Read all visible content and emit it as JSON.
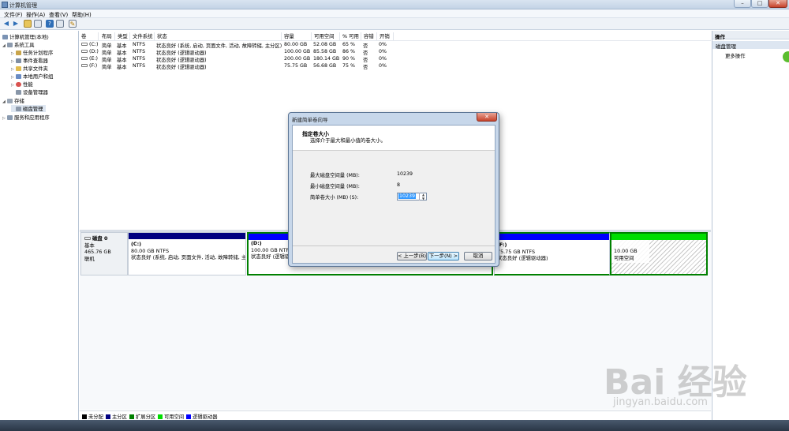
{
  "window": {
    "title": "计算机管理",
    "min": "–",
    "max": "□",
    "close": "✕"
  },
  "menu": [
    "文件(F)",
    "操作(A)",
    "查看(V)",
    "帮助(H)"
  ],
  "toolbar": [
    "back-icon",
    "forward-icon",
    "folder-icon",
    "properties-icon",
    "help-icon",
    "export-icon",
    "wizard-icon"
  ],
  "tree": {
    "root": "计算机管理(本地)",
    "system_tools": "系统工具",
    "task_scheduler": "任务计划程序",
    "event_viewer": "事件查看器",
    "shared_folders": "共享文件夹",
    "local_users": "本地用户和组",
    "performance": "性能",
    "device_manager": "设备管理器",
    "storage": "存储",
    "disk_management": "磁盘管理",
    "services": "服务和应用程序"
  },
  "volumes": {
    "headers": [
      "卷",
      "布局",
      "类型",
      "文件系统",
      "状态",
      "容量",
      "可用空间",
      "% 可用",
      "容错",
      "开销"
    ],
    "rows": [
      [
        "(C:)",
        "简单",
        "基本",
        "NTFS",
        "状态良好 (系统, 启动, 页面文件, 活动, 故障转储, 主分区)",
        "80.00 GB",
        "52.08 GB",
        "65 %",
        "否",
        "0%"
      ],
      [
        "(D:)",
        "简单",
        "基本",
        "NTFS",
        "状态良好 (逻辑驱动器)",
        "100.00 GB",
        "85.58 GB",
        "86 %",
        "否",
        "0%"
      ],
      [
        "(E:)",
        "简单",
        "基本",
        "NTFS",
        "状态良好 (逻辑驱动器)",
        "200.00 GB",
        "180.14 GB",
        "90 %",
        "否",
        "0%"
      ],
      [
        "(F:)",
        "简单",
        "基本",
        "NTFS",
        "状态良好 (逻辑驱动器)",
        "75.75 GB",
        "56.68 GB",
        "75 %",
        "否",
        "0%"
      ]
    ]
  },
  "disk": {
    "name": "磁盘 0",
    "type": "基本",
    "size": "465.76 GB",
    "status": "联机",
    "partitions": [
      {
        "name": "(C:)",
        "size": "80.00 GB NTFS",
        "status": "状态良好 (系统, 启动, 页面文件, 活动, 故障转储, 主",
        "color": "#000080"
      },
      {
        "name": "(D:)",
        "size": "100.00 GB NTFS",
        "status": "状态良好 (逻辑驱",
        "color": "#0000ff"
      },
      {
        "name": "(F:)",
        "size": "75.75 GB NTFS",
        "status": "状态良好 (逻辑驱动器)",
        "color": "#0000ff"
      },
      {
        "name": "",
        "size": "10.00 GB",
        "status": "可用空间",
        "color": "#00cc00"
      }
    ]
  },
  "legend": [
    {
      "label": "未分配",
      "color": "#000000"
    },
    {
      "label": "主分区",
      "color": "#000080"
    },
    {
      "label": "扩展分区",
      "color": "#008000"
    },
    {
      "label": "可用空间",
      "color": "#00dd00"
    },
    {
      "label": "逻辑驱动器",
      "color": "#0000ff"
    }
  ],
  "actions": {
    "header": "操作",
    "section": "磁盘管理",
    "more": "更多操作"
  },
  "dialog": {
    "title": "新建简单卷向导",
    "heading": "指定卷大小",
    "subheading": "选择介于最大和最小值的卷大小。",
    "max_label": "最大磁盘空间量 (MB):",
    "max_value": "10239",
    "min_label": "最小磁盘空间量 (MB):",
    "min_value": "8",
    "size_label": "简单卷大小 (MB) (S):",
    "size_value": "10239",
    "back": "< 上一步(B)",
    "next": "下一步(N) >",
    "cancel": "取消"
  },
  "watermark": {
    "brand": "Bai 经验",
    "url": "jingyan.baidu.com"
  }
}
